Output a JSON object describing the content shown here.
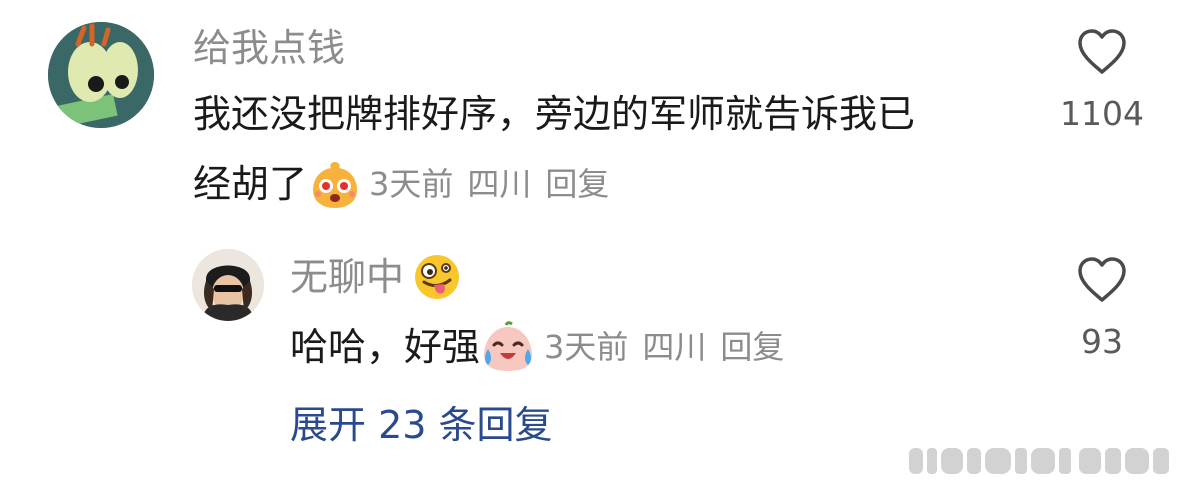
{
  "comment": {
    "username": "给我点钱",
    "avatar": "cartoon-avatar",
    "text_line1": "我还没把牌排好序，旁边的军师就告诉我已",
    "text_line2": "经胡了",
    "emoji": "surprised-star-eyes-emoji",
    "time": "3天前",
    "location": "四川",
    "reply_label": "回复",
    "likes": "1104"
  },
  "reply": {
    "username": "无聊中",
    "username_emoji": "zany-face-emoji",
    "avatar": "photo-avatar",
    "text": "哈哈，好强",
    "emoji": "laughing-tears-emoji",
    "time": "3天前",
    "location": "四川",
    "reply_label": "回复",
    "likes": "93"
  },
  "expand_label": "展开 23 条回复",
  "colors": {
    "text": "#1a1a1a",
    "meta": "#8c8c8c",
    "link": "#2a4a8f"
  }
}
